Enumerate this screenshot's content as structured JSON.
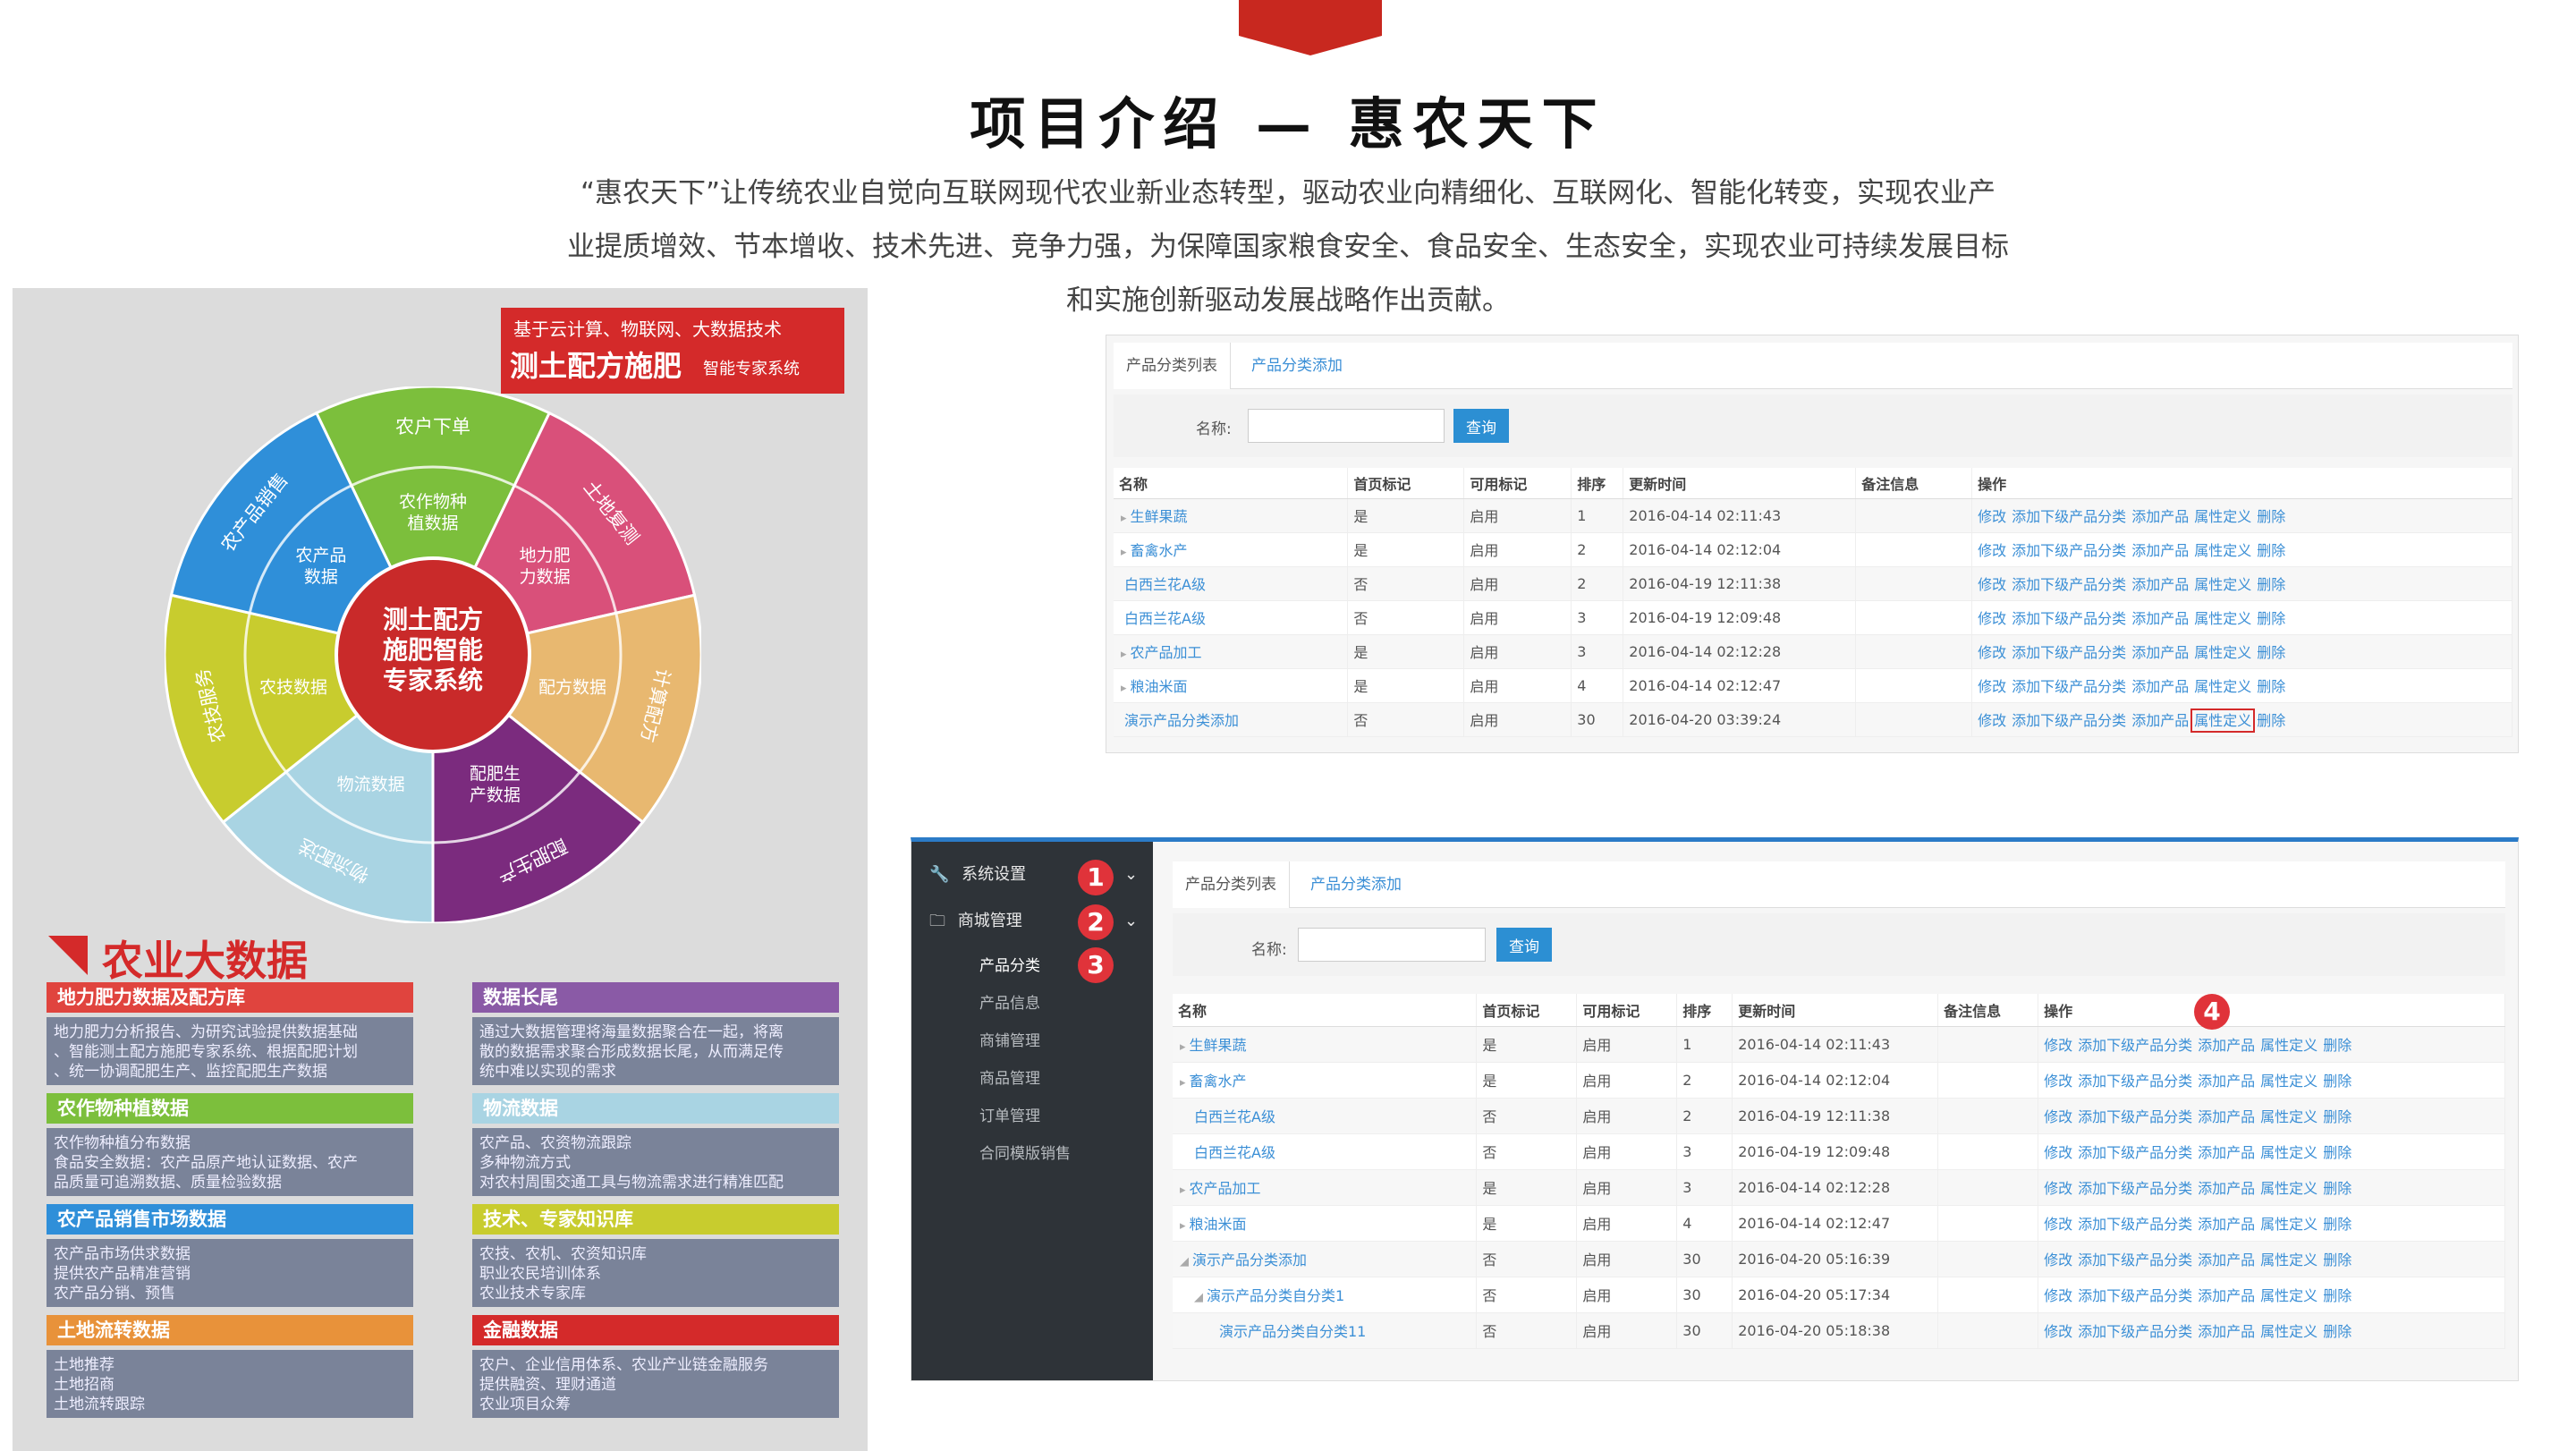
{
  "page": {
    "title": "项目介绍 — 惠农天下",
    "intro_lines": [
      "“惠农天下”让传统农业自觉向互联网现代农业新业态转型，驱动农业向精细化、互联网化、智能化转变，实现农业产",
      "业提质增效、节本增收、技术先进、竞争力强，为保障国家粮食安全、食品安全、生态安全，实现农业可持续发展目标",
      "和实施创新驱动发展战略作出贡献。"
    ],
    "accent": "#d42a2a"
  },
  "poster": {
    "badge_line1": "基于云计算、物联网、大数据技术",
    "badge_line2": "测土配方施肥",
    "badge_line3": "智能专家系统",
    "center_lines": [
      "测土配方",
      "施肥智能",
      "专家系统"
    ],
    "outer_sectors": [
      {
        "label": "农户下单",
        "color": "#7cbf3c"
      },
      {
        "label": "土地复测",
        "color": "#d9507a"
      },
      {
        "label": "计算配方",
        "color": "#e8b870"
      },
      {
        "label": "配肥生产",
        "color": "#7b2b7e"
      },
      {
        "label": "物流配送",
        "color": "#a9d4e3"
      },
      {
        "label": "农技服务",
        "color": "#c8cc2e"
      },
      {
        "label": "农产品销售",
        "color": "#2f8fd9"
      }
    ],
    "inner_sectors": [
      {
        "label": "农作物种植数据"
      },
      {
        "label": "地力肥力数据"
      },
      {
        "label": "配方数据"
      },
      {
        "label": "配肥生产数据"
      },
      {
        "label": "物流数据"
      },
      {
        "label": "农技数据"
      },
      {
        "label": "农产品数据"
      }
    ],
    "section_title": "农业大数据",
    "cards": [
      {
        "title": "地力肥力数据及配方库",
        "color": "#e0443e",
        "lines": [
          "地力肥力分析报告、为研究试验提供数据基础",
          "、智能测土配方施肥专家系统、根据配肥计划",
          "、统一协调配肥生产、监控配肥生产数据"
        ]
      },
      {
        "title": "数据长尾",
        "color": "#8a5aa6",
        "lines": [
          "通过大数据管理将海量数据聚合在一起，将离",
          "散的数据需求聚合形成数据长尾，从而满足传",
          "统中难以实现的需求"
        ]
      },
      {
        "title": "农作物种植数据",
        "color": "#7cbf3c",
        "lines": [
          "农作物种植分布数据",
          "食品安全数据：农产品原产地认证数据、农产",
          "品质量可追溯数据、质量检验数据"
        ]
      },
      {
        "title": "物流数据",
        "color": "#a9d4e3",
        "lines": [
          "农产品、农资物流跟踪",
          "多种物流方式",
          "对农村周围交通工具与物流需求进行精准匹配"
        ]
      },
      {
        "title": "农产品销售市场数据",
        "color": "#2f8fd9",
        "lines": [
          "农产品市场供求数据",
          "提供农产品精准营销",
          "农产品分销、预售"
        ]
      },
      {
        "title": "技术、专家知识库",
        "color": "#c8cc2e",
        "lines": [
          "农技、农机、农资知识库",
          "职业农民培训体系",
          "农业技术专家库"
        ]
      },
      {
        "title": "土地流转数据",
        "color": "#e8923a",
        "lines": [
          "土地推荐",
          "土地招商",
          "土地流转跟踪"
        ]
      },
      {
        "title": "金融数据",
        "color": "#d42a2a",
        "lines": [
          "农户、企业信用体系、农业产业链金融服务",
          "提供融资、理财通道",
          "农业项目众筹"
        ]
      }
    ]
  },
  "admin": {
    "tabs": [
      "产品分类列表",
      "产品分类添加"
    ],
    "search_label": "名称:",
    "search_value": "",
    "search_button": "查询",
    "columns": [
      "名称",
      "首页标记",
      "可用标记",
      "排序",
      "更新时间",
      "备注信息",
      "操作"
    ],
    "ops": [
      "修改",
      "添加下级产品分类",
      "添加产品",
      "属性定义",
      "删除"
    ],
    "rows1": [
      {
        "caret": "▸",
        "name": "生鲜果蔬",
        "home": "是",
        "avail": "启用",
        "sort": "1",
        "time": "2016-04-14 02:11:43"
      },
      {
        "caret": "▸",
        "name": "畜禽水产",
        "home": "是",
        "avail": "启用",
        "sort": "2",
        "time": "2016-04-14 02:12:04"
      },
      {
        "caret": "",
        "name": "白西兰花A级",
        "home": "否",
        "avail": "启用",
        "sort": "2",
        "time": "2016-04-19 12:11:38"
      },
      {
        "caret": "",
        "name": "白西兰花A级",
        "home": "否",
        "avail": "启用",
        "sort": "3",
        "time": "2016-04-19 12:09:48"
      },
      {
        "caret": "▸",
        "name": "农产品加工",
        "home": "是",
        "avail": "启用",
        "sort": "3",
        "time": "2016-04-14 02:12:28"
      },
      {
        "caret": "▸",
        "name": "粮油米面",
        "home": "是",
        "avail": "启用",
        "sort": "4",
        "time": "2016-04-14 02:12:47"
      },
      {
        "caret": "",
        "name": "演示产品分类添加",
        "home": "否",
        "avail": "启用",
        "sort": "30",
        "time": "2016-04-20 03:39:24"
      }
    ],
    "rows2": [
      {
        "caret": "▸",
        "name": "生鲜果蔬",
        "home": "是",
        "avail": "启用",
        "sort": "1",
        "time": "2016-04-14 02:11:43"
      },
      {
        "caret": "▸",
        "name": "畜禽水产",
        "home": "是",
        "avail": "启用",
        "sort": "2",
        "time": "2016-04-14 02:12:04"
      },
      {
        "caret": "",
        "name": "白西兰花A级",
        "home": "否",
        "avail": "启用",
        "sort": "2",
        "time": "2016-04-19 12:11:38"
      },
      {
        "caret": "",
        "name": "白西兰花A级",
        "home": "否",
        "avail": "启用",
        "sort": "3",
        "time": "2016-04-19 12:09:48"
      },
      {
        "caret": "▸",
        "name": "农产品加工",
        "home": "是",
        "avail": "启用",
        "sort": "3",
        "time": "2016-04-14 02:12:28"
      },
      {
        "caret": "▸",
        "name": "粮油米面",
        "home": "是",
        "avail": "启用",
        "sort": "4",
        "time": "2016-04-14 02:12:47"
      },
      {
        "caret": "◢",
        "name": "演示产品分类添加",
        "home": "否",
        "avail": "启用",
        "sort": "30",
        "time": "2016-04-20 05:16:39"
      },
      {
        "caret": "◢",
        "name": "演示产品分类自分类1",
        "home": "否",
        "avail": "启用",
        "sort": "30",
        "time": "2016-04-20 05:17:34"
      },
      {
        "caret": "",
        "name": "演示产品分类自分类11",
        "home": "否",
        "avail": "启用",
        "sort": "30",
        "time": "2016-04-20 05:18:38"
      }
    ],
    "sidebar": {
      "items": [
        "系统设置",
        "商城管理"
      ],
      "subitems": [
        "产品分类",
        "产品信息",
        "商铺管理",
        "商品管理",
        "订单管理",
        "合同模版销售"
      ]
    },
    "markers": [
      "1",
      "2",
      "3",
      "4"
    ]
  }
}
